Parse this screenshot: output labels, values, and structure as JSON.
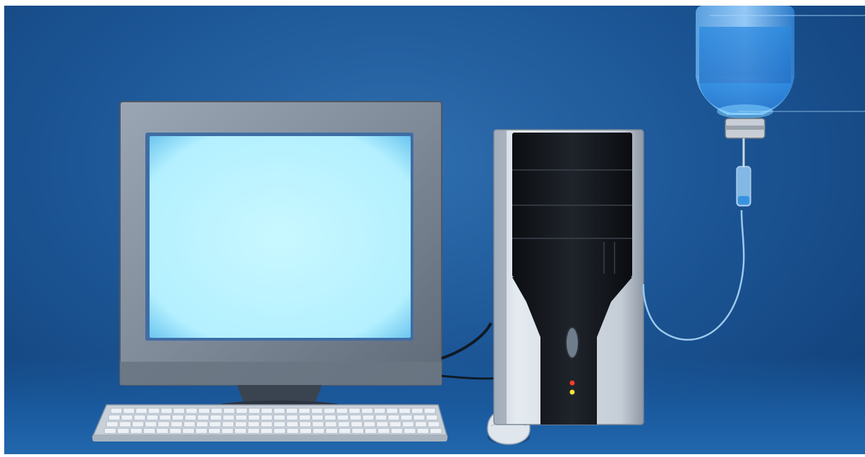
{
  "scene": {
    "subject": "computer-on-iv-drip",
    "colors": {
      "background": "#1d5797",
      "screen_glow": "#b5f2ff",
      "iv_fluid": "#2f8fe0",
      "led_red": "#ff3b2f",
      "led_yellow": "#f2e23a"
    },
    "icons": [
      "crt-monitor-icon",
      "tower-case-icon",
      "keyboard-icon",
      "mouse-icon",
      "iv-bag-icon",
      "iv-tube-icon"
    ]
  }
}
